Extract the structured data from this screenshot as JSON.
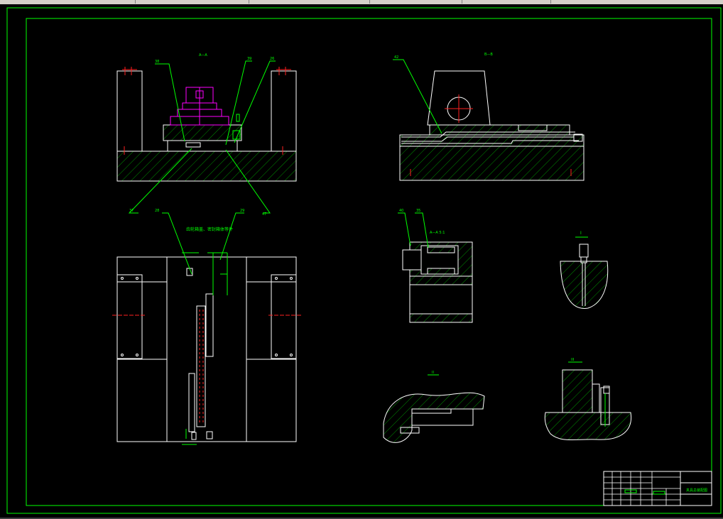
{
  "toolbar": {
    "segments": 7
  },
  "views": {
    "top_left_section": "A—A",
    "top_right_section": "B—B",
    "mid_center_section": "A—A  5:1",
    "detail_right_top": "I",
    "detail_right_bottom": "III",
    "detail_center_bottom": "II"
  },
  "notes": {
    "center_note": "齿轮箱盖、密封箱体等件"
  },
  "balloons": [
    "38",
    "39",
    "26",
    "37",
    "28",
    "29",
    "40",
    "35",
    "47",
    "42"
  ],
  "title_block": {
    "drawing_name": "夹具总装配图"
  },
  "colors": {
    "frame": "#00ff00",
    "outline": "#ffffff",
    "centerline": "#ff2020",
    "part_highlight": "#ff00ff",
    "background": "#000000"
  }
}
